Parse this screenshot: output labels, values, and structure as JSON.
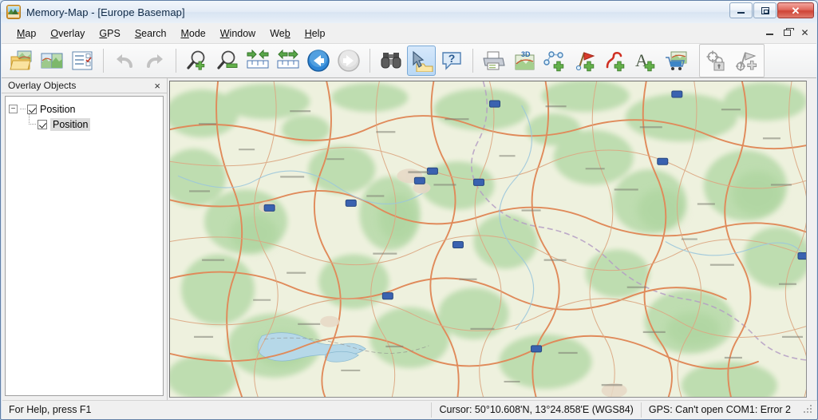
{
  "window": {
    "title": "Memory-Map - [Europe Basemap]",
    "app_icon": "memory-map-logo-icon",
    "minimize_label": "Minimize",
    "maximize_label": "Maximize",
    "close_label": "Close"
  },
  "menu": {
    "items": [
      {
        "label": "Map",
        "accel": "M"
      },
      {
        "label": "Overlay",
        "accel": "O"
      },
      {
        "label": "GPS",
        "accel": "G"
      },
      {
        "label": "Search",
        "accel": "S"
      },
      {
        "label": "Mode",
        "accel": "M"
      },
      {
        "label": "Window",
        "accel": "W"
      },
      {
        "label": "Web",
        "accel": "b"
      },
      {
        "label": "Help",
        "accel": "H"
      }
    ],
    "mdi": {
      "minimize": "_",
      "restore": "Restore",
      "close": "×"
    }
  },
  "toolbar": {
    "buttons": [
      {
        "name": "open-map-button",
        "icon": "open-folder-map-icon",
        "state": "enabled"
      },
      {
        "name": "select-map-button",
        "icon": "map-layers-icon",
        "state": "enabled"
      },
      {
        "name": "overlay-list-button",
        "icon": "checklist-icon",
        "state": "enabled"
      },
      {
        "name": "undo-button",
        "icon": "undo-arrow-icon",
        "state": "disabled"
      },
      {
        "name": "redo-button",
        "icon": "redo-arrow-icon",
        "state": "disabled"
      },
      {
        "name": "zoom-in-button",
        "icon": "magnifier-plus-icon",
        "state": "enabled"
      },
      {
        "name": "zoom-out-button",
        "icon": "magnifier-minus-icon",
        "state": "enabled"
      },
      {
        "name": "scale-larger-button",
        "icon": "arrows-in-ruler-icon",
        "state": "enabled"
      },
      {
        "name": "scale-smaller-button",
        "icon": "arrows-out-ruler-icon",
        "state": "enabled"
      },
      {
        "name": "back-button",
        "icon": "back-arrow-icon",
        "state": "enabled"
      },
      {
        "name": "forward-button",
        "icon": "forward-arrow-icon",
        "state": "disabled"
      },
      {
        "name": "find-button",
        "icon": "binoculars-icon",
        "state": "enabled"
      },
      {
        "name": "select-tool-button",
        "icon": "cursor-pointer-icon",
        "state": "active"
      },
      {
        "name": "help-button",
        "icon": "question-balloon-icon",
        "state": "enabled"
      },
      {
        "name": "print-button",
        "icon": "printer-icon",
        "state": "enabled"
      },
      {
        "name": "three-d-view-button",
        "icon": "3d-map-icon",
        "state": "enabled"
      },
      {
        "name": "add-route-button",
        "icon": "route-plus-icon",
        "state": "enabled"
      },
      {
        "name": "add-waypoint-button",
        "icon": "flag-plus-icon",
        "state": "enabled"
      },
      {
        "name": "add-track-button",
        "icon": "track-plus-icon",
        "state": "enabled"
      },
      {
        "name": "add-text-button",
        "icon": "text-plus-icon",
        "state": "enabled"
      },
      {
        "name": "shop-button",
        "icon": "shopping-cart-map-icon",
        "state": "enabled"
      },
      {
        "name": "lock-position-button",
        "icon": "crosshair-lock-icon",
        "state": "disabled"
      },
      {
        "name": "mark-position-button",
        "icon": "crosshair-flag-plus-icon",
        "state": "disabled"
      }
    ]
  },
  "dock": {
    "title": "Overlay Objects",
    "close_glyph": "×",
    "tree": {
      "root": {
        "label": "Position",
        "checked": true,
        "expanded": true,
        "expander_glyph": "−"
      },
      "child": {
        "label": "Position",
        "checked": true,
        "selected": true
      }
    }
  },
  "statusbar": {
    "help_text": "For Help, press F1",
    "cursor": "Cursor: 50°10.608'N, 13°24.858'E (WGS84)",
    "gps": "GPS: Can't open COM1: Error 2"
  },
  "map": {
    "document_title": "Europe Basemap",
    "colors": {
      "land": "#eef0dd",
      "forest": "#bcdcb0",
      "road_major": "#e08a5a",
      "road_minor": "#d9a07a",
      "motorway_shield": "#3a62b0",
      "water": "#b9d9e8",
      "border": "#b9a8c0"
    }
  }
}
